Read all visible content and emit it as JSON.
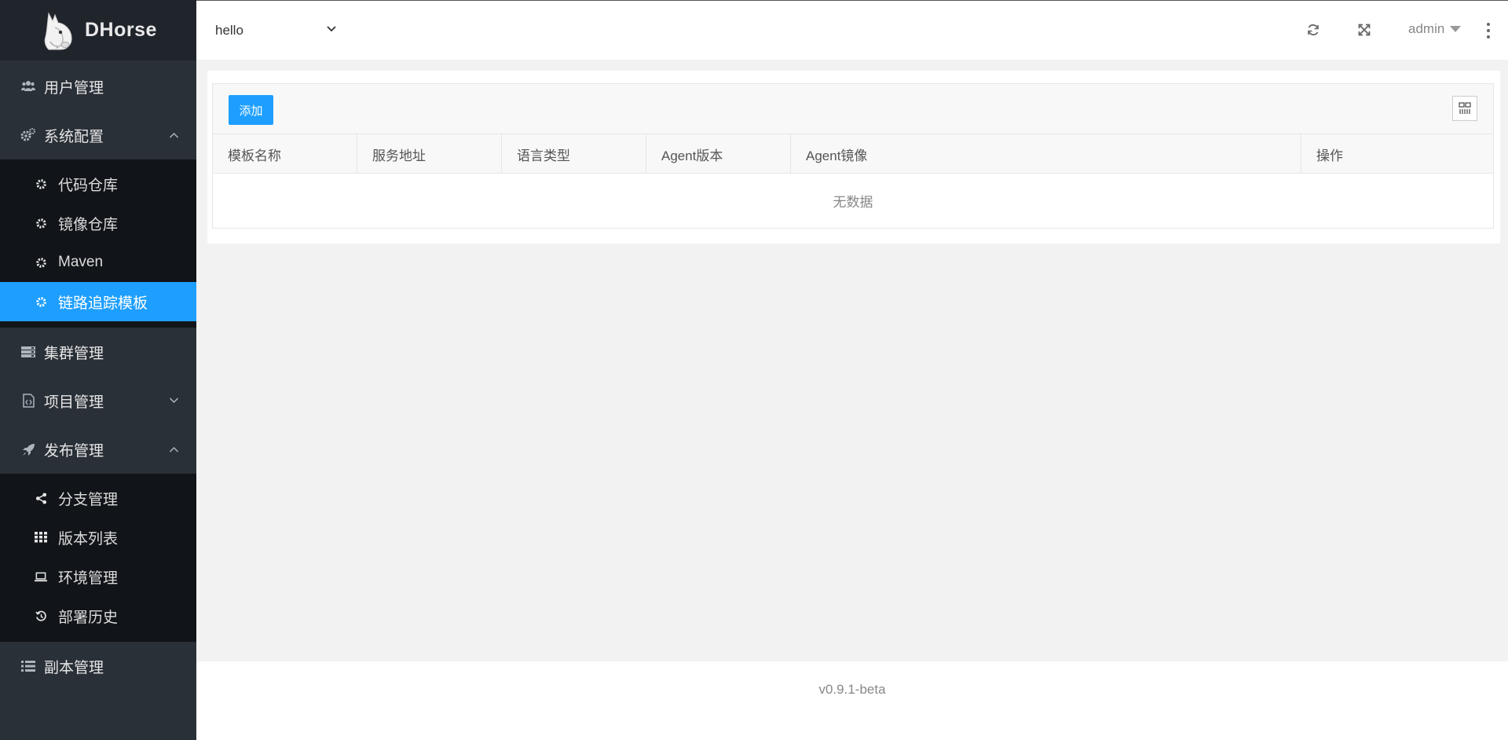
{
  "app": {
    "name": "DHorse"
  },
  "sidebar": {
    "items": [
      {
        "label": "用户管理",
        "icon": "users-icon"
      },
      {
        "label": "系统配置",
        "icon": "gears-icon",
        "expanded": true,
        "children": [
          {
            "label": "代码仓库",
            "icon": "gear-icon"
          },
          {
            "label": "镜像仓库",
            "icon": "gear-icon"
          },
          {
            "label": "Maven",
            "icon": "gear-icon"
          },
          {
            "label": "链路追踪模板",
            "icon": "gear-icon",
            "active": true
          }
        ]
      },
      {
        "label": "集群管理",
        "icon": "server-icon"
      },
      {
        "label": "项目管理",
        "icon": "file-code-icon",
        "expanded": false
      },
      {
        "label": "发布管理",
        "icon": "rocket-icon",
        "expanded": true,
        "children": [
          {
            "label": "分支管理",
            "icon": "share-icon"
          },
          {
            "label": "版本列表",
            "icon": "grid-icon"
          },
          {
            "label": "环境管理",
            "icon": "laptop-icon"
          },
          {
            "label": "部署历史",
            "icon": "history-icon"
          }
        ]
      },
      {
        "label": "副本管理",
        "icon": "list-icon"
      }
    ]
  },
  "header": {
    "app_select": {
      "value": "hello"
    },
    "user": "admin"
  },
  "toolbar": {
    "add_label": "添加"
  },
  "table": {
    "columns": [
      "模板名称",
      "服务地址",
      "语言类型",
      "Agent版本",
      "Agent镜像",
      "操作"
    ],
    "rows": [],
    "empty_text": "无数据"
  },
  "footer": {
    "version": "v0.9.1-beta"
  },
  "colors": {
    "accent": "#1e9fff",
    "sidebar_bg": "#2a3038",
    "submenu_bg": "#111418"
  }
}
